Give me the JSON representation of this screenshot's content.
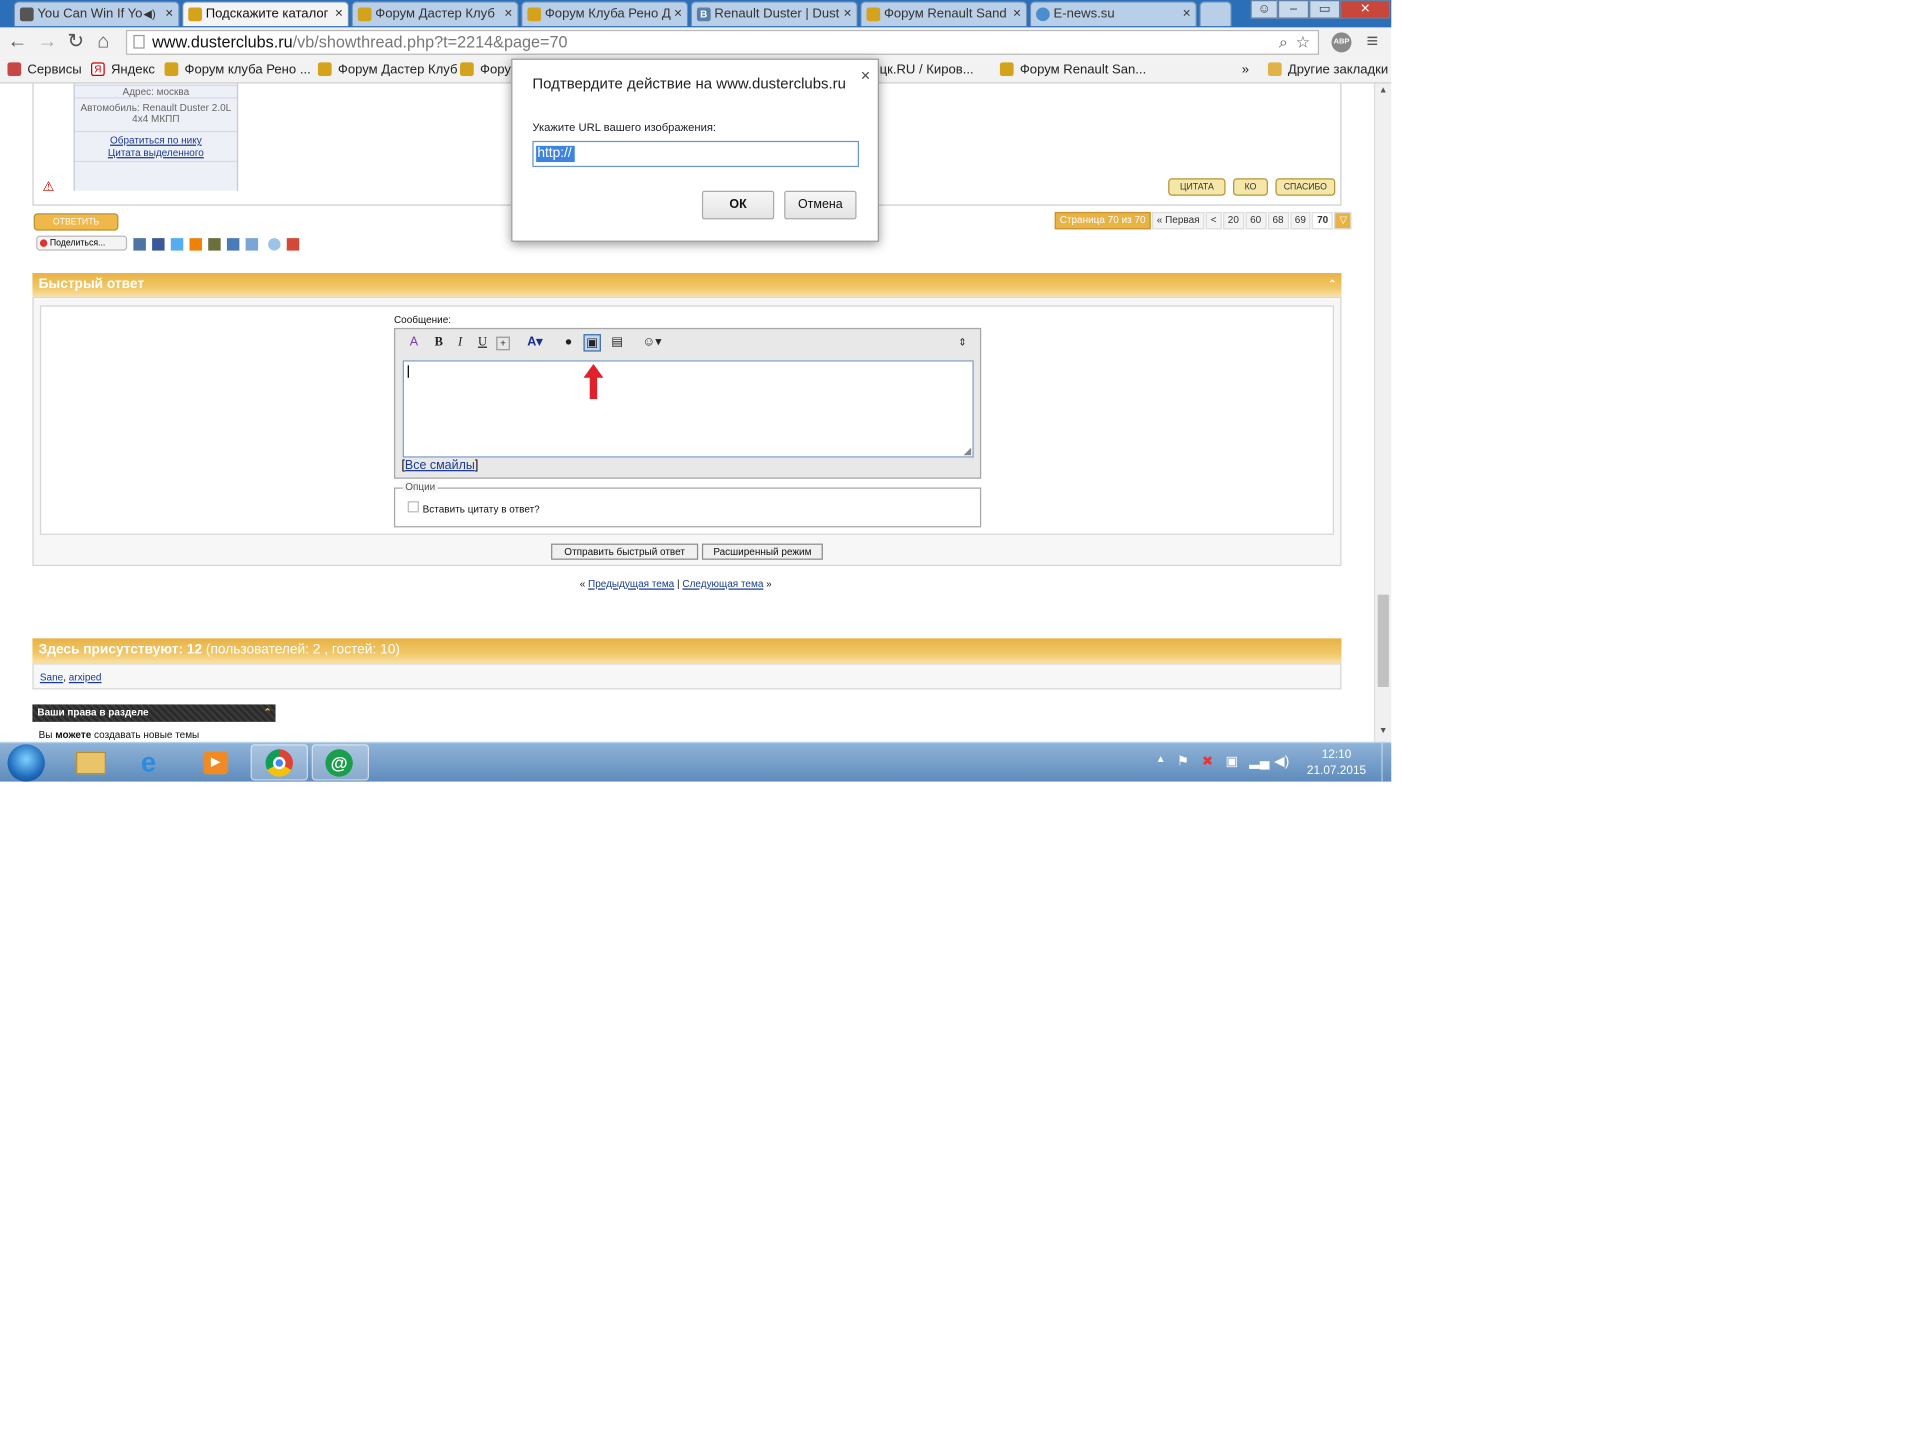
{
  "browser": {
    "tabs": [
      {
        "title": "You Can Win If Yo",
        "icon": "play-icon"
      },
      {
        "title": "Подскажите каталог",
        "icon": "renault-icon"
      },
      {
        "title": "Форум Дастер Клуб",
        "icon": "renault-icon"
      },
      {
        "title": "Форум Клуба Рено Д",
        "icon": "renault-icon"
      },
      {
        "title": "Renault Duster | Dust",
        "icon": "vk-icon"
      },
      {
        "title": "Форум Renault Sand",
        "icon": "renault-icon"
      },
      {
        "title": "E-news.su",
        "icon": "globe-icon"
      }
    ],
    "close_glyph": "×",
    "url_host": "www.dusterclubs.ru",
    "url_path": "/vb/showthread.php?t=2214&page=70",
    "extension_badge": "ABP",
    "bookmarks": [
      {
        "label": "Сервисы",
        "icon": "apps-icon"
      },
      {
        "label": "Яндекс",
        "icon": "yandex-icon"
      },
      {
        "label": "Форум клуба Рено ...",
        "icon": "renault-icon"
      },
      {
        "label": "Форум Дастер Клуб",
        "icon": "renault-icon"
      },
      {
        "label": "Форум",
        "icon": "renault-icon"
      },
      {
        "label": "пецк.RU / Киров...",
        "icon": "none"
      },
      {
        "label": "Форум Renault San...",
        "icon": "renault-icon"
      }
    ],
    "bookmarks_more": "»",
    "other_bookmarks": "Другие закладки"
  },
  "post": {
    "address": "Адрес: москва",
    "car": "Автомобиль: Renault Duster 2.0L 4x4 МКПП",
    "link_nick": "Обратиться по нику",
    "link_quote": "Цитата выделенного",
    "btn_quote": "ЦИТАТА",
    "btn_ko": "КО",
    "btn_thanks": "СПАСИБО",
    "btn_reply": "ОТВЕТИТЬ",
    "share": "Поделиться..."
  },
  "pager": {
    "label": "Страница 70 из 70",
    "first": "« Первая",
    "prev": "<",
    "pages": [
      "20",
      "60",
      "68",
      "69",
      "70"
    ]
  },
  "quick_reply": {
    "title": "Быстрый ответ",
    "message_label": "Сообщение:",
    "all_smilies": "Все смайлы",
    "options_legend": "Опции",
    "quote_checkbox": "Вставить цитату в ответ?",
    "submit": "Отправить быстрый ответ",
    "advanced": "Расширенный режим"
  },
  "thread_nav": {
    "prev": "Предыдущая тема",
    "separator": "|",
    "next": "Следующая тема"
  },
  "online": {
    "title": "Здесь присутствуют: 12",
    "detail": "(пользователей: 2 , гостей: 10)",
    "users": [
      "Sane",
      "arxiped"
    ]
  },
  "rights": {
    "title": "Ваши права в разделе",
    "line_prefix": "Вы",
    "line_bold": "можете",
    "line_rest": "создавать новые темы"
  },
  "dialog": {
    "title": "Подтвердите действие на www.dusterclubs.ru",
    "label": "Укажите URL вашего изображения:",
    "value": "http://",
    "ok": "ОК",
    "cancel": "Отмена",
    "close": "×"
  },
  "taskbar": {
    "time": "12:10",
    "date": "21.07.2015",
    "apps": [
      "windows-start-icon",
      "file-explorer-icon",
      "internet-explorer-icon",
      "media-player-icon",
      "chrome-icon",
      "mail-agent-icon"
    ]
  },
  "colors": {
    "titlebar": "#2a6fb8",
    "forum_gold": "#e8b245",
    "arrow_red": "#e0202a",
    "link": "#1a3b8f"
  }
}
